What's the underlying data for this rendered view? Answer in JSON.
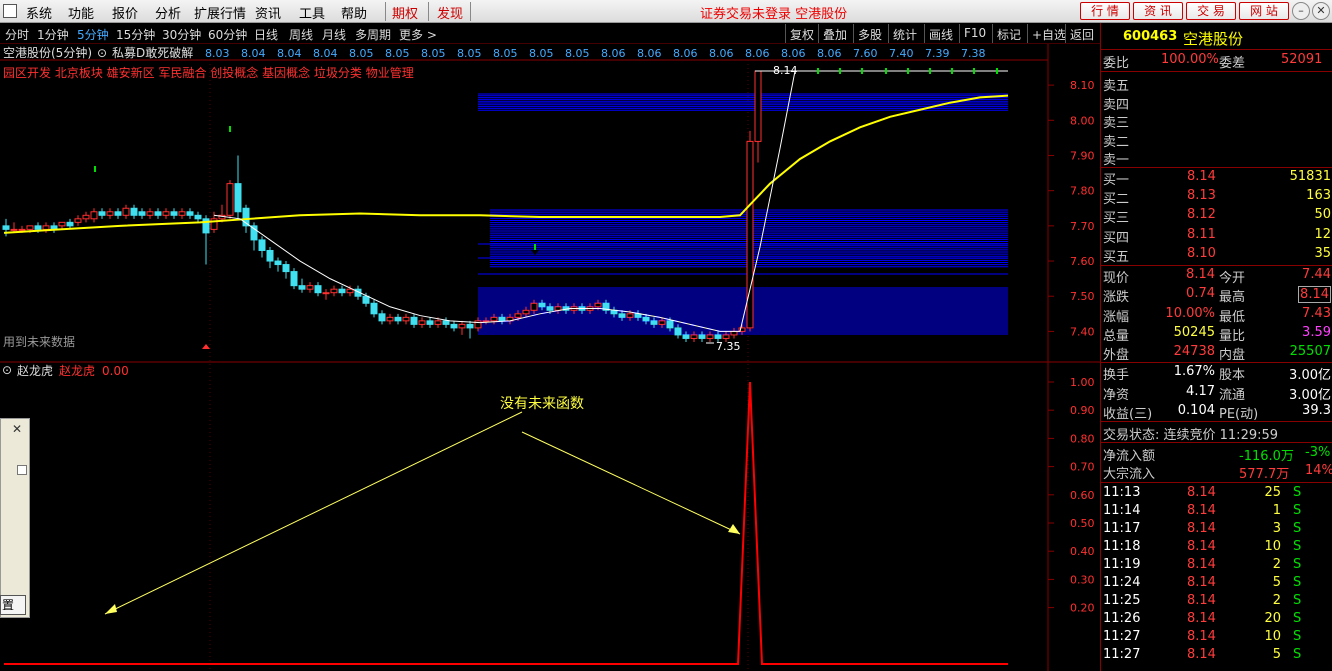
{
  "menu": {
    "items": [
      "系统",
      "功能",
      "报价",
      "分析",
      "扩展行情",
      "资讯",
      "工具",
      "帮助"
    ],
    "period_tab": "期权",
    "discover_tab": "发现",
    "status_text": "证券交易未登录 空港股份",
    "right_buttons": [
      "行 情",
      "资 讯",
      "交 易",
      "网 站"
    ]
  },
  "periodbar": {
    "periods": [
      "分时",
      "1分钟",
      "5分钟",
      "15分钟",
      "30分钟",
      "60分钟",
      "日线",
      "周线",
      "月线",
      "多周期",
      "更多 >"
    ],
    "active_index": 2,
    "tools": [
      "复权",
      "叠加",
      "多股",
      "统计",
      "画线",
      "F10",
      "标记",
      "+自选",
      "返回"
    ]
  },
  "main_chart": {
    "title": "空港股份(5分钟)",
    "indicator_label": "私募D敢死破解",
    "date_ticks": [
      "8.03",
      "8.04",
      "8.04",
      "8.04",
      "8.05",
      "8.05",
      "8.05",
      "8.05",
      "8.05",
      "8.05",
      "8.05",
      "8.06",
      "8.06",
      "8.06",
      "8.06",
      "8.06",
      "8.06",
      "8.06",
      "7.60",
      "7.40",
      "7.39",
      "7.38"
    ],
    "concept_tags": "园区开发 北京板块 雄安新区 军民融合 创投概念 基因概念 垃圾分类 物业管理",
    "warning_text": "用到未来数据",
    "high_label": "8.14",
    "low_label": "7.35",
    "price_axis": [
      "8.10",
      "8.00",
      "7.90",
      "7.80",
      "7.70",
      "7.60",
      "7.50",
      "7.40"
    ],
    "colors": {
      "up": "#ff3030",
      "down": "#40e0f0",
      "avg": "#ffff00",
      "ma": "#ffffff",
      "band": "#0000ff",
      "arrow": "#00e000"
    }
  },
  "chart_data": [
    {
      "type": "candlestick",
      "title": "空港股份(5分钟)",
      "y_axis_labels": [
        "8.10",
        "8.00",
        "7.90",
        "7.80",
        "7.70",
        "7.60",
        "7.50",
        "7.40"
      ],
      "ylim": [
        7.35,
        8.16
      ],
      "high": 8.14,
      "low": 7.35,
      "series": [
        {
          "name": "price",
          "shape": "candles"
        },
        {
          "name": "avg",
          "color": "#ffff00"
        },
        {
          "name": "ma",
          "color": "#ffffff"
        }
      ]
    },
    {
      "type": "line",
      "title": "赵龙虎",
      "series": [
        {
          "name": "赵龙虎",
          "color": "#ff0000",
          "values": [
            0,
            0,
            0,
            0,
            0,
            0,
            0,
            0,
            0,
            0,
            0,
            0,
            0,
            0,
            0,
            0,
            0,
            0,
            0,
            0,
            0,
            0,
            0,
            0,
            1,
            0,
            0,
            0,
            0,
            0,
            0,
            0,
            0,
            0,
            0,
            0,
            0,
            0,
            0,
            0,
            0,
            0,
            0,
            0,
            0,
            0,
            0,
            0,
            0,
            0
          ],
          "current": "0.00"
        }
      ],
      "y_axis_labels": [
        "1.00",
        "0.90",
        "0.80",
        "0.70",
        "0.60",
        "0.50",
        "0.40",
        "0.30",
        "0.20"
      ],
      "ylim": [
        0,
        1
      ]
    }
  ],
  "sub_chart": {
    "name": "赵龙虎",
    "label": "赵龙虎",
    "value": "0.00",
    "annotation": "没有未来函数",
    "axis": [
      "1.00",
      "0.90",
      "0.80",
      "0.70",
      "0.60",
      "0.50",
      "0.40",
      "0.30",
      "0.20"
    ]
  },
  "dialog": {
    "close": "✕",
    "button": "置"
  },
  "quote": {
    "code": "600463",
    "name": "空港股份",
    "webi_label": "委比",
    "webi": "100.00%",
    "weicha_label": "委差",
    "weicha": "52091",
    "sells": [
      {
        "label": "卖五"
      },
      {
        "label": "卖四"
      },
      {
        "label": "卖三"
      },
      {
        "label": "卖二"
      },
      {
        "label": "卖一"
      }
    ],
    "buys": [
      {
        "label": "买一",
        "price": "8.14",
        "vol": "51831"
      },
      {
        "label": "买二",
        "price": "8.13",
        "vol": "163"
      },
      {
        "label": "买三",
        "price": "8.12",
        "vol": "50"
      },
      {
        "label": "买四",
        "price": "8.11",
        "vol": "12"
      },
      {
        "label": "买五",
        "price": "8.10",
        "vol": "35"
      }
    ],
    "stats": [
      {
        "l1": "现价",
        "v1": "8.14",
        "l2": "今开",
        "v2": "7.44"
      },
      {
        "l1": "涨跌",
        "v1": "0.74",
        "l2": "最高",
        "v2": "8.14"
      },
      {
        "l1": "涨幅",
        "v1": "10.00%",
        "l2": "最低",
        "v2": "7.43"
      },
      {
        "l1": "总量",
        "v1": "50245",
        "l2": "量比",
        "v2": "3.59"
      },
      {
        "l1": "外盘",
        "v1": "24738",
        "l2": "内盘",
        "v2": "25507"
      }
    ],
    "stats2": [
      {
        "l1": "换手",
        "v1": "1.67%",
        "l2": "股本",
        "v2": "3.00亿"
      },
      {
        "l1": "净资",
        "v1": "4.17",
        "l2": "流通",
        "v2": "3.00亿"
      },
      {
        "l1": "收益(三)",
        "v1": "0.104",
        "l2": "PE(动)",
        "v2": "39.3"
      }
    ],
    "trade_state": "交易状态: 连续竞价 11:29:59",
    "flow1": {
      "label": "净流入额",
      "value": "-116.0万",
      "pct": "-3%"
    },
    "flow2": {
      "label": "大宗流入",
      "value": "577.7万",
      "pct": "14%"
    },
    "ticks": [
      {
        "t": "11:13",
        "p": "8.14",
        "v": "25",
        "s": "S"
      },
      {
        "t": "11:14",
        "p": "8.14",
        "v": "1",
        "s": "S"
      },
      {
        "t": "11:17",
        "p": "8.14",
        "v": "3",
        "s": "S"
      },
      {
        "t": "11:18",
        "p": "8.14",
        "v": "10",
        "s": "S"
      },
      {
        "t": "11:19",
        "p": "8.14",
        "v": "2",
        "s": "S"
      },
      {
        "t": "11:24",
        "p": "8.14",
        "v": "5",
        "s": "S"
      },
      {
        "t": "11:25",
        "p": "8.14",
        "v": "2",
        "s": "S"
      },
      {
        "t": "11:26",
        "p": "8.14",
        "v": "20",
        "s": "S"
      },
      {
        "t": "11:27",
        "p": "8.14",
        "v": "10",
        "s": "S"
      },
      {
        "t": "11:27",
        "p": "8.14",
        "v": "5",
        "s": "S"
      }
    ]
  }
}
